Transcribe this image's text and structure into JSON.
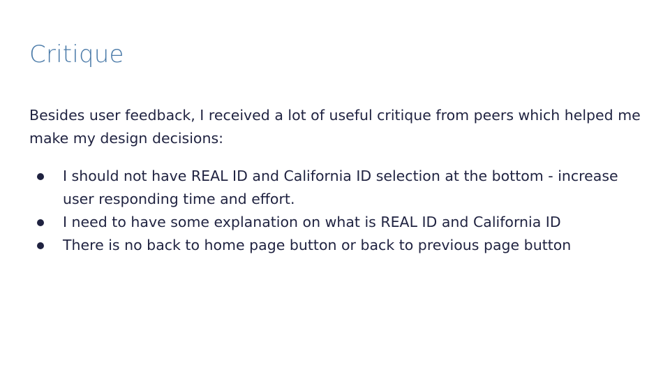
{
  "slide": {
    "title": "Critique",
    "intro": "Besides user feedback, I received a lot of useful critique from peers which helped me make my design decisions:",
    "bullets": [
      "I should not have REAL ID and California ID selection at the bottom - increase user responding time and effort.",
      "I need to have some explanation on what is REAL ID and California ID",
      "There is no back to home page button or back to previous page button"
    ]
  },
  "colors": {
    "title": "#4a7aa8",
    "text": "#1f2240",
    "background": "#ffffff"
  }
}
